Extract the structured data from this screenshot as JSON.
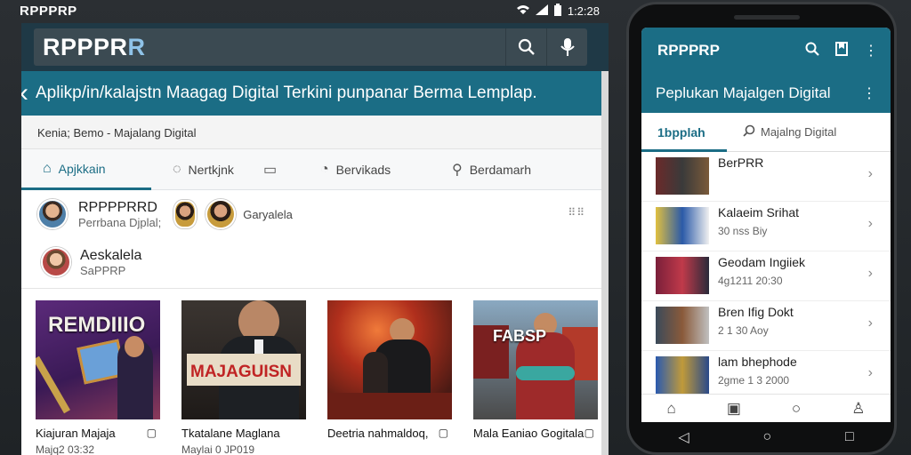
{
  "status": {
    "brand": "RPPPRP",
    "time": "1:2:28"
  },
  "tablet": {
    "search": {
      "title_main": "RPPPR",
      "title_accent": "R"
    },
    "title": "Aplikp/in/kalajstn Maagag Digital Terkini punpanar Berma Lemplap.",
    "breadcrumb": "Kenia; Bemo - Majalang Digital",
    "tabs": [
      {
        "label": "Apjkkain",
        "icon": "home-icon"
      },
      {
        "label": "Nertkjnk",
        "icon": "chat-icon"
      },
      {
        "label": "",
        "icon": "message-icon"
      },
      {
        "label": "Bervikads",
        "icon": "timer-icon"
      },
      {
        "label": "Berdamarh",
        "icon": "search-icon"
      }
    ],
    "users": [
      {
        "name": "RPPPPRRD",
        "sub": "Perrbana Djplal;"
      },
      {
        "name": "",
        "sub": "Garyalela"
      },
      {
        "name": "Aeskalela",
        "sub": "SaPPRP"
      }
    ],
    "more": "⠿⠿",
    "cards": [
      {
        "title": "Kiajuran Majaja",
        "sub": "Majq2 03:32",
        "thumb_text": "REMDIIIO"
      },
      {
        "title": "Tkatalane Maglana",
        "sub": "Maylai 0 JP019",
        "thumb_text": "MAJAGUISN"
      },
      {
        "title": "Deetria nahmaldoq,",
        "sub": "",
        "thumb_text": ""
      },
      {
        "title": "Mala Eaniao Gogitala",
        "sub": "",
        "thumb_text": "FABSP"
      }
    ]
  },
  "phone": {
    "app_name": "RPPPRP",
    "title": "Peplukan Majalgen Digital",
    "tabs": {
      "active": "1bpplah",
      "second": "Majalng Digital"
    },
    "list": [
      {
        "title": "BerPRR",
        "sub": ""
      },
      {
        "title": "Kalaeim Srihat",
        "sub": "30 nss Biy"
      },
      {
        "title": "Geodam Ingiiek",
        "sub": "4g1211 20:30"
      },
      {
        "title": "Bren Ifig Dokt",
        "sub": "2 1 30 Aoy"
      },
      {
        "title": "lam bhephode",
        "sub": "2gme 1 3 2000"
      }
    ]
  },
  "colors": {
    "accent": "#1b6d85",
    "search_bg": "#1f3946"
  }
}
